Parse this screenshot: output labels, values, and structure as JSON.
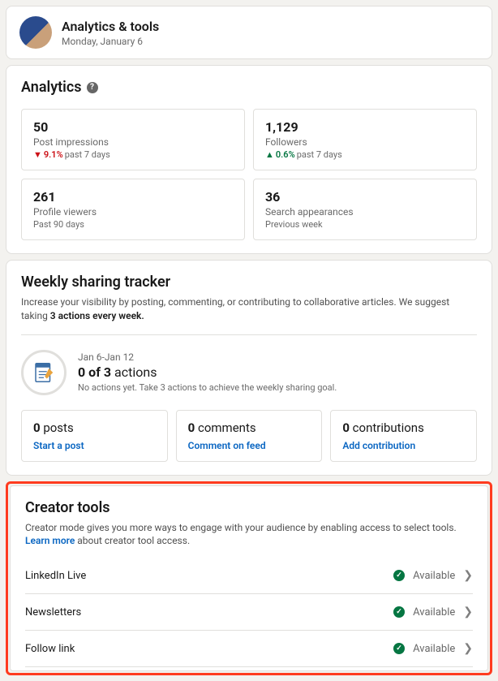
{
  "header": {
    "title": "Analytics & tools",
    "date": "Monday, January 6"
  },
  "analytics": {
    "title": "Analytics",
    "stats": [
      {
        "num": "50",
        "label": "Post impressions",
        "delta": "9.1%",
        "dir": "down",
        "period": "past 7 days"
      },
      {
        "num": "1,129",
        "label": "Followers",
        "delta": "0.6%",
        "dir": "up",
        "period": "past 7 days"
      },
      {
        "num": "261",
        "label": "Profile viewers",
        "delta": "",
        "dir": "",
        "period": "Past 90 days"
      },
      {
        "num": "36",
        "label": "Search appearances",
        "delta": "",
        "dir": "",
        "period": "Previous week"
      }
    ]
  },
  "tracker": {
    "title": "Weekly sharing tracker",
    "desc_pre": "Increase your visibility by posting, commenting, or contributing to collaborative articles. We suggest taking ",
    "desc_bold": "3 actions every week.",
    "range": "Jan 6-Jan 12",
    "count_bold": "0 of 3",
    "count_suffix": " actions",
    "hint": "No actions yet. Take 3 actions to achieve the weekly sharing goal.",
    "actions": [
      {
        "num": "0",
        "label": " posts",
        "link": "Start a post"
      },
      {
        "num": "0",
        "label": " comments",
        "link": "Comment on feed"
      },
      {
        "num": "0",
        "label": " contributions",
        "link": "Add contribution"
      }
    ]
  },
  "creator": {
    "title": "Creator tools",
    "desc": "Creator mode gives you more ways to engage with your audience by enabling access to select tools. ",
    "learn": "Learn more",
    "desc2": " about creator tool access.",
    "available": "Available",
    "tools": [
      {
        "name": "LinkedIn Live"
      },
      {
        "name": "Newsletters"
      },
      {
        "name": "Follow link"
      }
    ]
  }
}
